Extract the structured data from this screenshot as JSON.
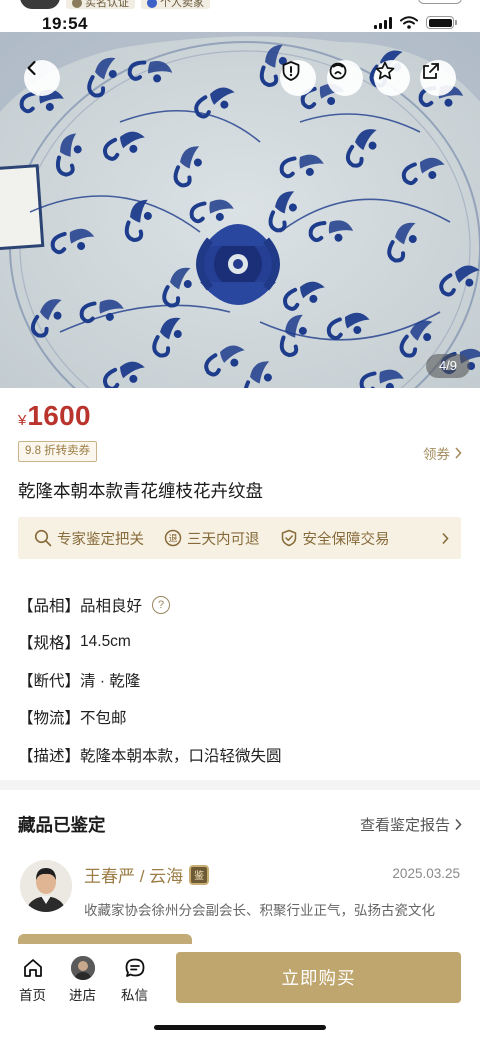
{
  "status_bar": {
    "time": "19:54",
    "badges": [
      "实名认证",
      "个人卖家"
    ]
  },
  "gallery": {
    "counter": "4/9",
    "icons": [
      "back-icon",
      "report-icon",
      "share-circle-icon",
      "favorite-star-icon",
      "share-out-icon"
    ]
  },
  "product": {
    "currency_symbol": "¥",
    "price": "1600",
    "discount_tag": "9.8 折转卖券",
    "coupon_label": "领券",
    "title": "乾隆本朝本款青花缠枝花卉纹盘"
  },
  "guarantees": [
    {
      "icon": "search-icon",
      "label": "专家鉴定把关"
    },
    {
      "icon": "return-icon",
      "label": "三天内可退"
    },
    {
      "icon": "shield-check-icon",
      "label": "安全保障交易"
    }
  ],
  "attributes": [
    {
      "key": "【品相】",
      "value": "品相良好"
    },
    {
      "key": "【规格】",
      "value": "14.5cm"
    },
    {
      "key": "【断代】",
      "value": "清 · 乾隆"
    },
    {
      "key": "【物流】",
      "value": "不包邮"
    },
    {
      "key": "【描述】",
      "value": "乾隆本朝本款，口沿轻微失圆"
    }
  ],
  "authentication": {
    "title": "藏品已鉴定",
    "report_link": "查看鉴定报告",
    "expert_name": "王春严 / 云海",
    "badge_text": "鉴",
    "date": "2025.03.25",
    "description": "收藏家协会徐州分会副会长、积聚行业正气，弘扬古瓷文化"
  },
  "bottom_nav": {
    "home": "首页",
    "store": "进店",
    "message": "私信",
    "buy": "立即购买"
  },
  "colors": {
    "price": "#b8342c",
    "gold": "#bfa66e",
    "gold_text": "#9b7d45",
    "cobalt": "#1e3c8c"
  }
}
